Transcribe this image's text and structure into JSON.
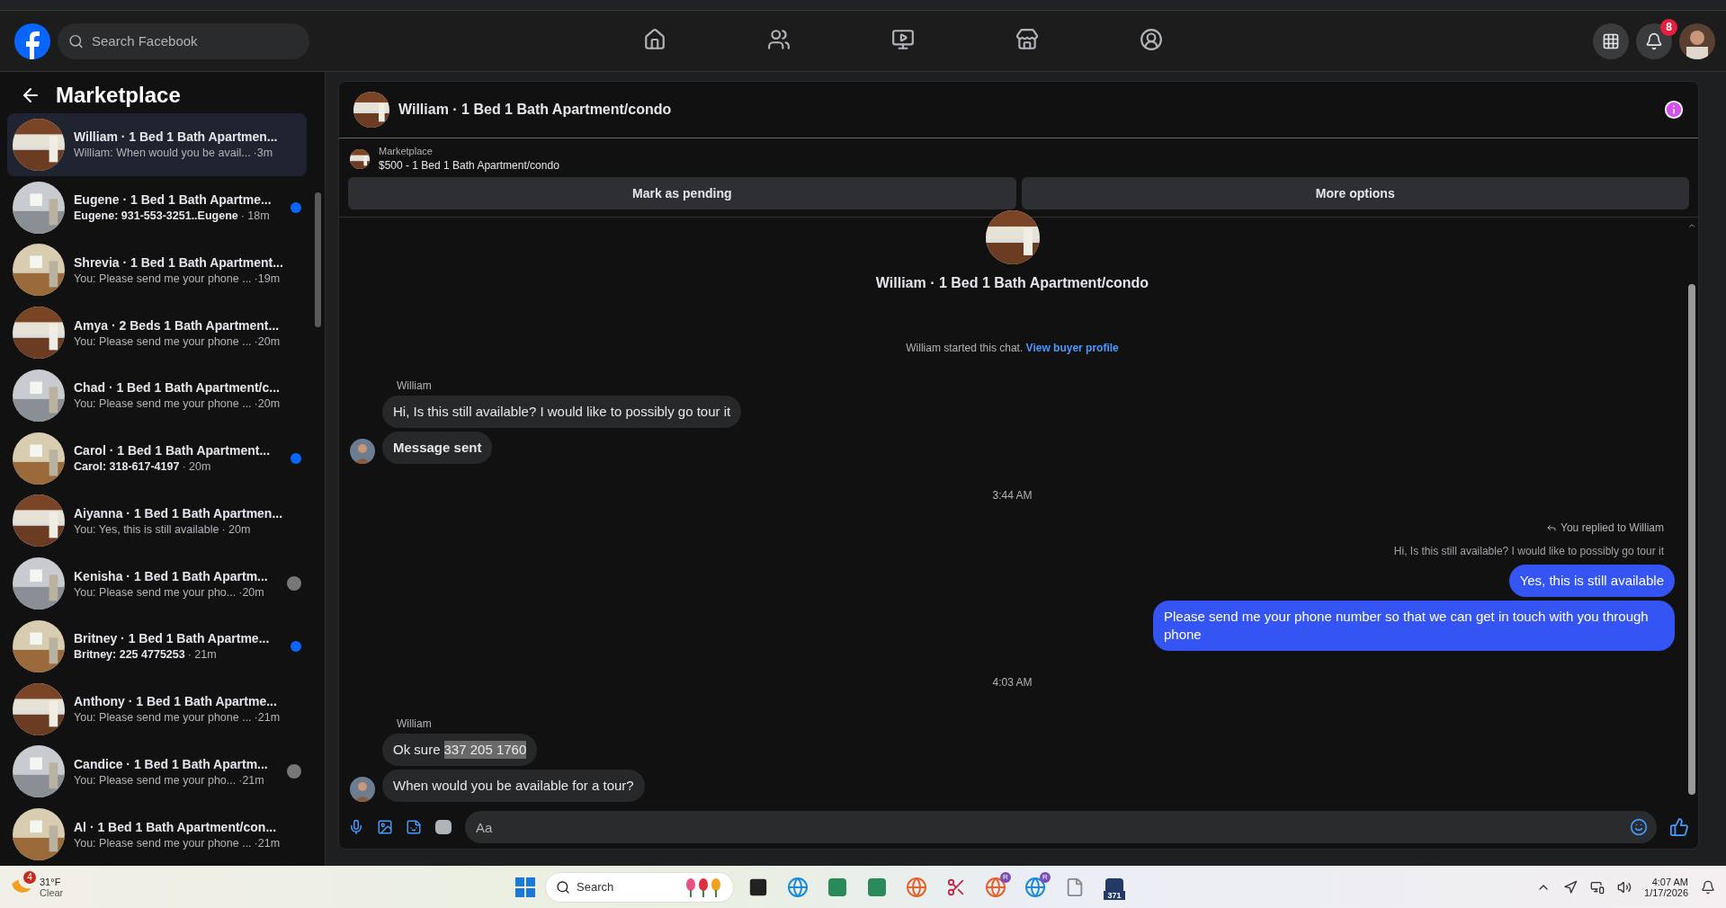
{
  "topbar": {
    "search": {
      "placeholder": "Search Facebook"
    },
    "nav": [
      {
        "selected": false
      },
      {
        "selected": false
      },
      {
        "selected": false
      },
      {
        "selected": false
      },
      {
        "selected": false
      }
    ],
    "notifications_badge": "8"
  },
  "sidebar": {
    "title": "Marketplace",
    "conversations": [
      {
        "title": "William · 1 Bed 1 Bath Apartmen...",
        "preview": "William: When would you be avail...",
        "time": "·3m",
        "selected": true,
        "unread": false,
        "seen": false
      },
      {
        "title": "Eugene · 1 Bed 1 Bath Apartme...",
        "preview": "Eugene: 931-553-3251..Eugene",
        "time": "· 18m",
        "selected": false,
        "unread": true,
        "seen": false
      },
      {
        "title": "Shrevia · 1 Bed 1 Bath Apartment...",
        "preview": "You: Please send me your phone ...",
        "time": "·19m",
        "selected": false,
        "unread": false,
        "seen": false
      },
      {
        "title": "Amya · 2 Beds 1 Bath Apartment...",
        "preview": "You: Please send me your phone ...",
        "time": "·20m",
        "selected": false,
        "unread": false,
        "seen": false
      },
      {
        "title": "Chad · 1 Bed 1 Bath Apartment/c...",
        "preview": "You: Please send me your phone ...",
        "time": "·20m",
        "selected": false,
        "unread": false,
        "seen": false
      },
      {
        "title": "Carol · 1 Bed 1 Bath Apartment...",
        "preview": "Carol: 318-617-4197",
        "time": "· 20m",
        "selected": false,
        "unread": true,
        "seen": false
      },
      {
        "title": "Aiyanna · 1 Bed 1 Bath Apartmen...",
        "preview": "You: Yes, this is still available",
        "time": "· 20m",
        "selected": false,
        "unread": false,
        "seen": false
      },
      {
        "title": "Kenisha · 1 Bed 1 Bath Apartm...",
        "preview": "You: Please send me your pho...",
        "time": "·20m",
        "selected": false,
        "unread": false,
        "seen": true
      },
      {
        "title": "Britney · 1 Bed 1 Bath Apartme...",
        "preview": "Britney: 225 4775253",
        "time": "· 21m",
        "selected": false,
        "unread": true,
        "seen": false
      },
      {
        "title": "Anthony · 1 Bed 1 Bath Apartme...",
        "preview": "You: Please send me your phone ...",
        "time": "·21m",
        "selected": false,
        "unread": false,
        "seen": false
      },
      {
        "title": "Candice · 1 Bed 1 Bath Apartm...",
        "preview": "You: Please send me your pho...",
        "time": "·21m",
        "selected": false,
        "unread": false,
        "seen": true
      },
      {
        "title": "Al · 1 Bed 1 Bath Apartment/con...",
        "preview": "You: Please send me your phone ...",
        "time": "·21m",
        "selected": false,
        "unread": false,
        "seen": false
      }
    ]
  },
  "chat": {
    "title": "William · 1 Bed 1 Bath Apartment/condo",
    "listing": {
      "source": "Marketplace",
      "name": "$500 - 1 Bed 1 Bath Apartment/condo"
    },
    "actions": [
      "Mark as pending",
      "More options"
    ],
    "intro": {
      "title": "William · 1 Bed 1 Bath Apartment/condo",
      "note": "William started this chat.",
      "link": "View buyer profile"
    },
    "items": [
      {
        "kind": "sender",
        "text": "William"
      },
      {
        "kind": "incoming",
        "text": "Hi, Is this still available? I would like to possibly go tour it",
        "avatar": false
      },
      {
        "kind": "incoming",
        "text": "Message sent",
        "bold": true,
        "avatar": true
      },
      {
        "kind": "time",
        "text": "3:44 AM"
      },
      {
        "kind": "reply",
        "label": "You replied to William",
        "quote": "Hi, Is this still available? I would like to possibly go tour it"
      },
      {
        "kind": "outgoing",
        "text": "Yes, this is still available"
      },
      {
        "kind": "outgoing",
        "text": "Please send me your phone  number so that we can get in touch with you through phone"
      },
      {
        "kind": "time",
        "text": "4:03 AM"
      },
      {
        "kind": "sender",
        "text": "William"
      },
      {
        "kind": "incoming",
        "text": "Ok sure",
        "highlight": "337 205 1760",
        "avatar": false
      },
      {
        "kind": "incoming",
        "text": "When would you be available for a tour?",
        "avatar": true
      }
    ],
    "composer": {
      "placeholder": "Aa"
    }
  },
  "taskbar": {
    "weather": {
      "temp": "31°F",
      "condition": "Clear",
      "badge": "4"
    },
    "search": {
      "placeholder": "Search"
    },
    "apps": [
      {
        "kind": "square"
      },
      {
        "kind": "globe"
      },
      {
        "kind": "tile"
      },
      {
        "kind": "tile"
      },
      {
        "kind": "globe"
      },
      {
        "kind": "scissors"
      },
      {
        "kind": "globe",
        "badge": "R"
      },
      {
        "kind": "globe",
        "badge": "R"
      },
      {
        "kind": "file"
      },
      {
        "kind": "tile",
        "label": "371"
      }
    ],
    "time": "4:07 AM",
    "date": "1/17/2026"
  }
}
